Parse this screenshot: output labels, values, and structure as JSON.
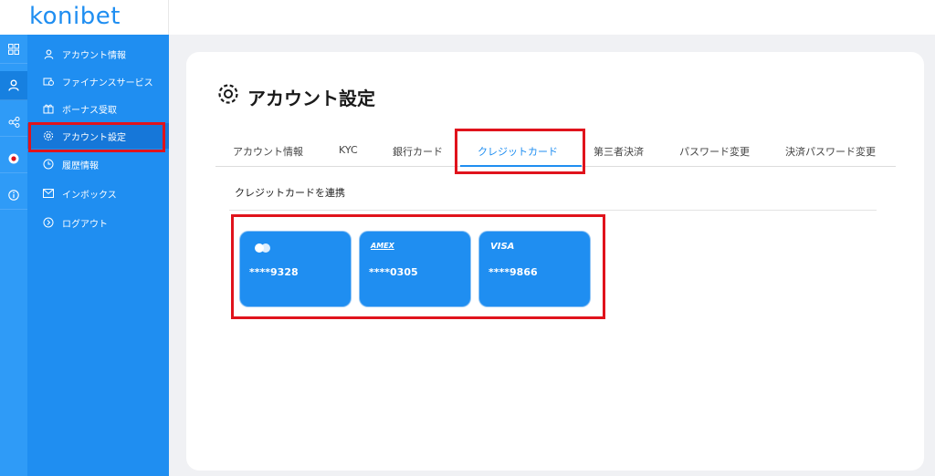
{
  "brand": {
    "logo": "konibet"
  },
  "rail": {
    "icons": [
      "grid-icon",
      "user-icon",
      "share-icon",
      "flag-icon",
      "info-icon"
    ]
  },
  "sidebar": {
    "items": [
      {
        "label": "アカウント情報",
        "icon": "user-icon"
      },
      {
        "label": "ファイナンスサービス",
        "icon": "finance-icon"
      },
      {
        "label": "ボーナス受取",
        "icon": "bonus-icon"
      },
      {
        "label": "アカウント設定",
        "icon": "gear-icon"
      },
      {
        "label": "履歴情報",
        "icon": "history-icon"
      },
      {
        "label": "インボックス",
        "icon": "mail-icon"
      },
      {
        "label": "ログアウト",
        "icon": "logout-icon"
      }
    ]
  },
  "page": {
    "title": "アカウント設定"
  },
  "tabs": [
    {
      "label": "アカウント情報"
    },
    {
      "label": "KYC"
    },
    {
      "label": "銀行カード"
    },
    {
      "label": "クレジットカード"
    },
    {
      "label": "第三者決済"
    },
    {
      "label": "パスワード変更"
    },
    {
      "label": "決済パスワード変更"
    }
  ],
  "cards_section": {
    "heading": "クレジットカードを連携"
  },
  "cards": [
    {
      "brand": "",
      "brand_icon": "mastercard-icon",
      "number": "****9328"
    },
    {
      "brand": "AMEX",
      "brand_icon": "amex-icon",
      "number": "****0305"
    },
    {
      "brand": "VISA",
      "brand_icon": "visa-icon",
      "number": "****9866"
    }
  ],
  "colors": {
    "accent": "#1f8ef1",
    "highlight": "#e0131c"
  }
}
